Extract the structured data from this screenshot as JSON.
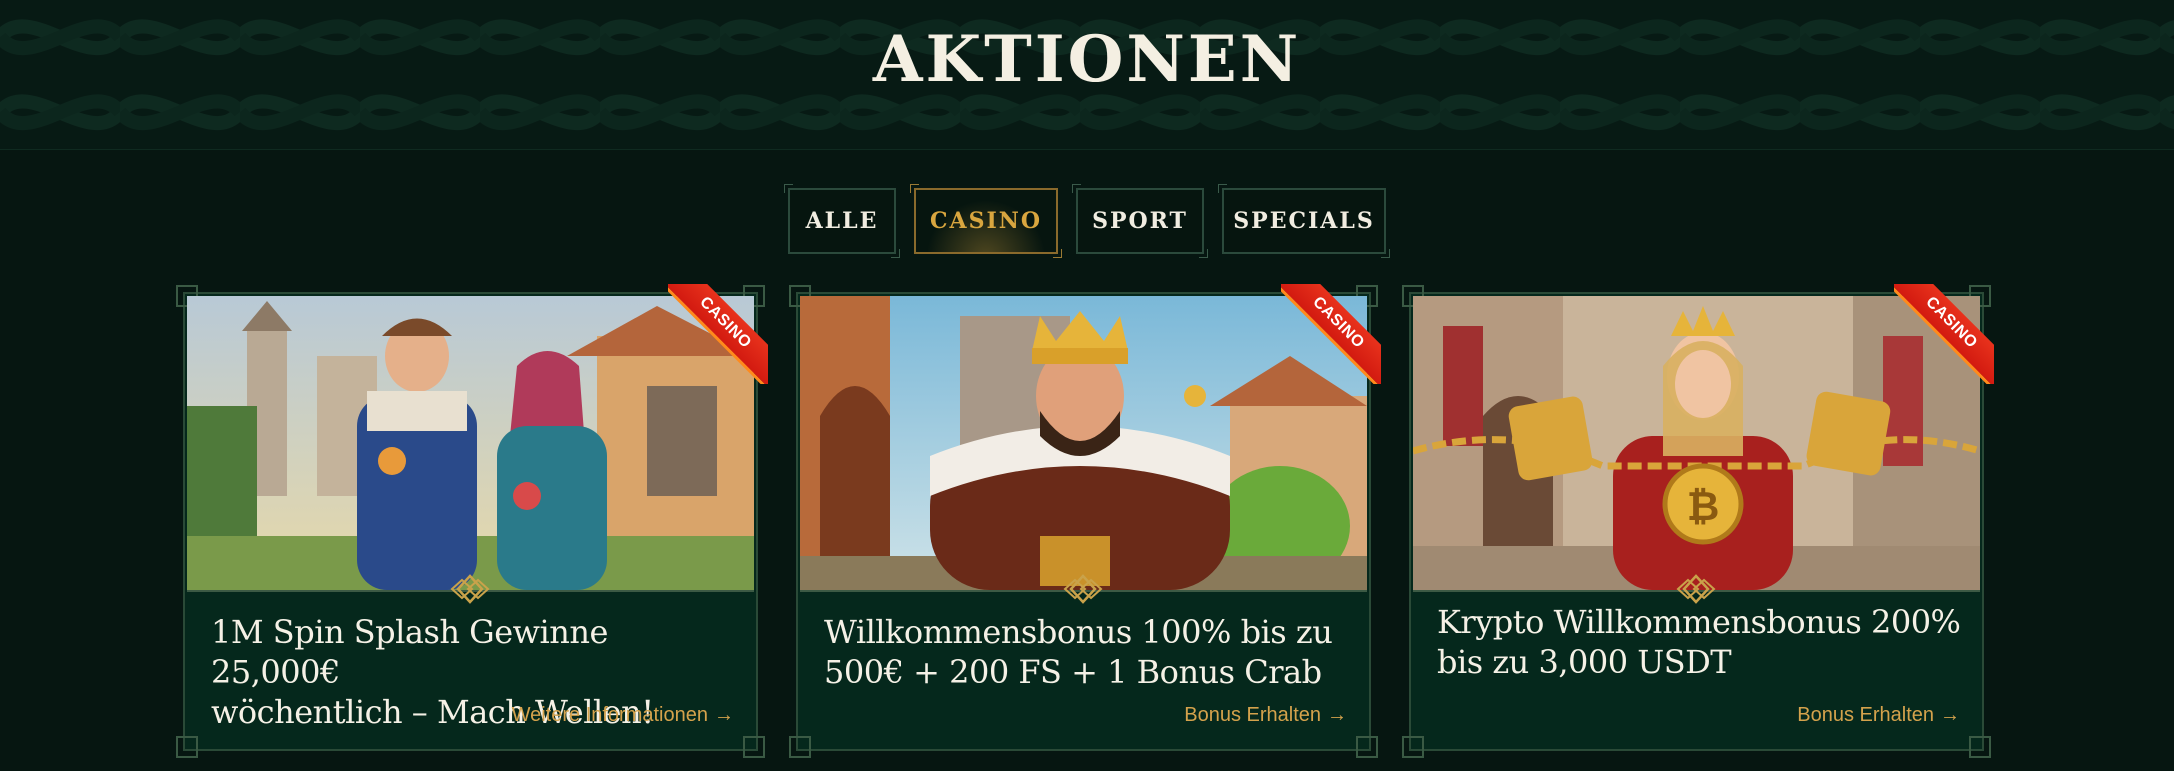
{
  "page": {
    "title": "AKTIONEN"
  },
  "tabs": [
    {
      "label": "ALLE",
      "active": false
    },
    {
      "label": "CASINO",
      "active": true
    },
    {
      "label": "SPORT",
      "active": false
    },
    {
      "label": "SPECIALS",
      "active": false
    }
  ],
  "cards": [
    {
      "ribbon": "CASINO",
      "title_line1": "1M Spin Splash Gewinne 25,000€",
      "title_line2": "wöchentlich – Mach Wellen!",
      "link": "Weitere Informationen",
      "link_icon": "arrow-right-icon"
    },
    {
      "ribbon": "CASINO",
      "title_line1": "Willkommensbonus 100% bis zu",
      "title_line2": "500€ + 200 FS + 1 Bonus Crab",
      "link": "Bonus Erhalten",
      "link_icon": "arrow-right-icon"
    },
    {
      "ribbon": "CASINO",
      "title_line1": "Krypto Willkommensbonus 200%",
      "title_line2": "bis zu 3,000 USDT",
      "link": "Bonus Erhalten",
      "link_icon": "arrow-right-icon"
    }
  ],
  "colors": {
    "background": "#061611",
    "accent_gold": "#d9a63f",
    "card_bg": "#05281c",
    "ribbon_red": "#e8321c"
  }
}
